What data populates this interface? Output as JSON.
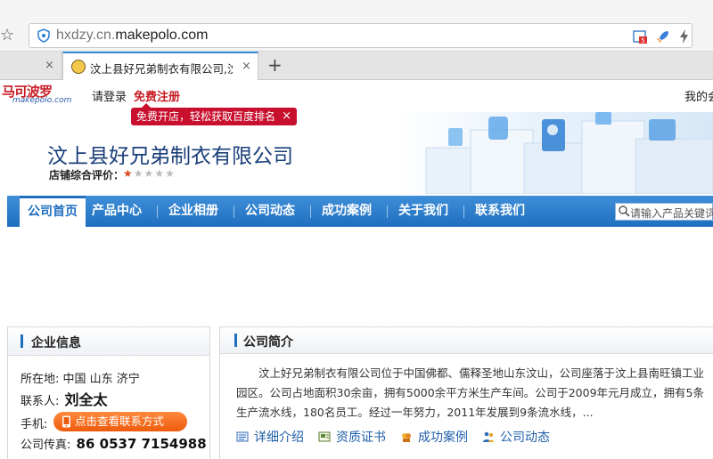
{
  "browser": {
    "url_prefix": "hxdzy.cn.",
    "url_domain": "makepolo.com",
    "tab_title": "汶上县好兄弟制衣有限公司,汶...",
    "close_symbol": "×",
    "new_tab_symbol": "+",
    "bookmark_symbol": "☆",
    "ext_badge": "5"
  },
  "site": {
    "logo_cn": "马可波罗",
    "logo_en": "makepolo.com",
    "login": "请登录",
    "register": "免费注册",
    "my_account": "我的会",
    "promo": "免费开店，轻松获取百度排名"
  },
  "banner": {
    "company_name": "汶上县好兄弟制衣有限公司",
    "rating_label": "店铺综合评价：",
    "rating": 1,
    "rating_max": 5
  },
  "nav": {
    "items": [
      "公司首页",
      "产品中心",
      "企业相册",
      "公司动态",
      "成功案例",
      "关于我们",
      "联系我们"
    ],
    "active": 0,
    "search_placeholder": "请输入产品关键词"
  },
  "info": {
    "title": "企业信息",
    "location_label": "所在地:",
    "location_value": "中国  山东  济宁",
    "contact_label": "联系人:",
    "contact_value": "刘全太",
    "phone_label": "手机:",
    "phone_button": "点击查看联系方式",
    "fax_label": "公司传真:",
    "fax_value": "86 0537 7154988"
  },
  "intro": {
    "title": "公司简介",
    "text": "汶上好兄弟制衣有限公司位于中国佛都、儒释圣地山东汶山，公司座落于汶上县南旺镇工业园区。公司占地面积30余亩，拥有5000余平方米生产车间。公司于2009年元月成立，拥有5条生产流水线，180名员工。经过一年努力，2011年发展到9条流水线，...",
    "links": [
      "详细介绍",
      "资质证书",
      "成功案例",
      "公司动态"
    ]
  },
  "colors": {
    "accent": "#1f6fbf",
    "brand_red": "#c81d25",
    "button_orange": "#ee5a0c"
  }
}
